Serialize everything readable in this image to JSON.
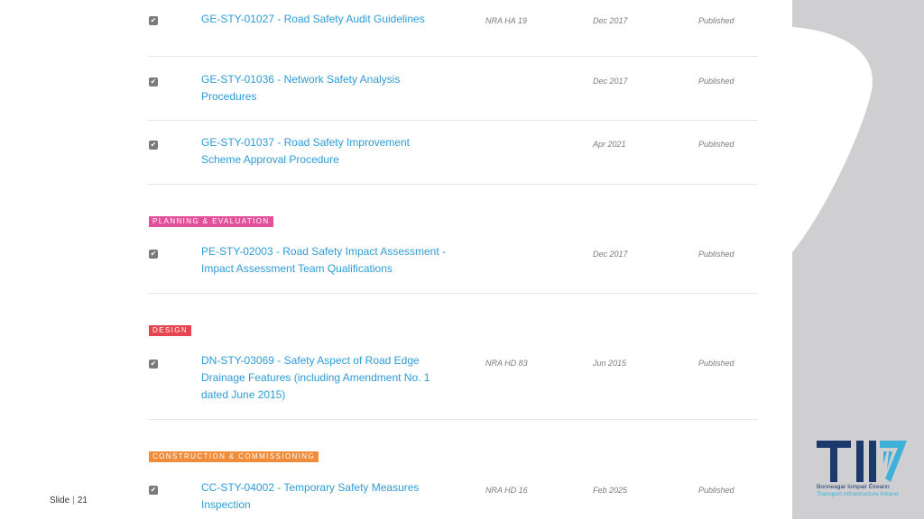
{
  "colors": {
    "link": "#2d9cd6",
    "planning": "#e3519a",
    "design": "#e6454f",
    "construction": "#f08c3a",
    "panel": "#cfcfd1",
    "logo_navy": "#1b3a6b",
    "logo_blue": "#3fb0d8"
  },
  "rows": [
    {
      "title": "GE-STY-01027 - Road Safety Audit Guidelines",
      "ref": "NRA HA 19",
      "date": "Dec 2017",
      "status": "Published",
      "checked": "✔"
    },
    {
      "title": "GE-STY-01036 - Network Safety Analysis Procedures",
      "ref": "",
      "date": "Dec 2017",
      "status": "Published",
      "checked": "✔"
    },
    {
      "title": "GE-STY-01037 - Road Safety Improvement Scheme Approval Procedure",
      "ref": "",
      "date": "Apr 2021",
      "status": "Published",
      "checked": "✔"
    },
    {
      "title": "PE-STY-02003 - Road Safety Impact Assessment - Impact Assessment Team Qualifications",
      "ref": "",
      "date": "Dec 2017",
      "status": "Published",
      "checked": "✔"
    },
    {
      "title": "DN-STY-03069 - Safety Aspect of Road Edge Drainage Features (including Amendment No. 1 dated June 2015)",
      "ref": "NRA HD 83",
      "date": "Jun 2015",
      "status": "Published",
      "checked": "✔"
    },
    {
      "title": "CC-STY-04002 - Temporary Safety Measures Inspection",
      "ref": "NRA HD 16",
      "date": "Feb 2025",
      "status": "Published",
      "checked": "✔"
    }
  ],
  "sections": {
    "planning": "PLANNING & EVALUATION",
    "design": "DESIGN",
    "construction": "CONSTRUCTION & COMMISSIONING"
  },
  "footer": {
    "slide_label": "Slide",
    "separator": "|",
    "slide_number": "21"
  },
  "logo": {
    "line1": "Bonneagar Iompair Éireann",
    "line2": "Transport Infrastructure Ireland"
  }
}
